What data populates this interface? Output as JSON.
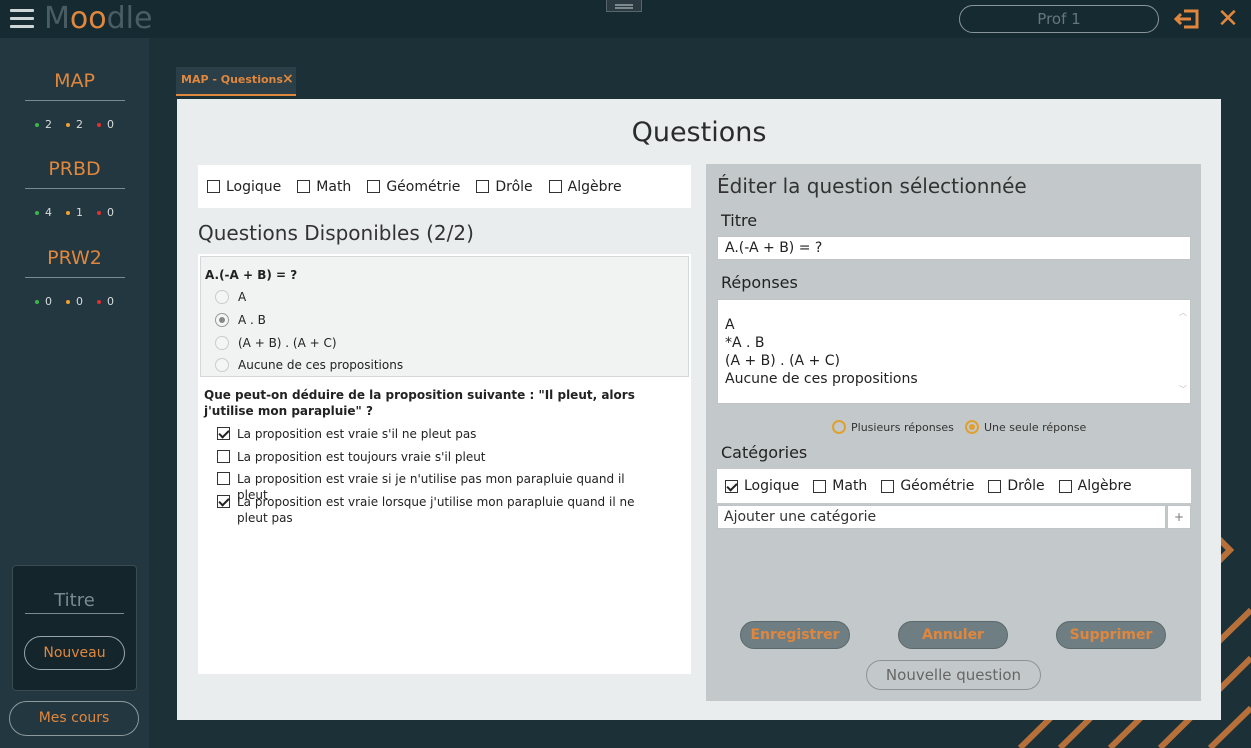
{
  "app": {
    "logo": {
      "m": "M",
      "oo": "oo",
      "dle": "dle"
    },
    "user": "Prof 1"
  },
  "sidebar": {
    "courses": [
      {
        "name": "MAP",
        "green": "2",
        "orange": "2",
        "red": "0"
      },
      {
        "name": "PRBD",
        "green": "4",
        "orange": "1",
        "red": "0"
      },
      {
        "name": "PRW2",
        "green": "0",
        "orange": "0",
        "red": "0"
      }
    ],
    "titre_label": "Titre",
    "nouveau_label": "Nouveau",
    "mescours_label": "Mes cours"
  },
  "tab": {
    "label": "MAP - Questions",
    "close": "×"
  },
  "page": {
    "title": "Questions"
  },
  "filters": [
    {
      "label": "Logique",
      "checked": false
    },
    {
      "label": "Math",
      "checked": false
    },
    {
      "label": "Géométrie",
      "checked": false
    },
    {
      "label": "Drôle",
      "checked": false
    },
    {
      "label": "Algèbre",
      "checked": false
    }
  ],
  "available": {
    "title": "Questions Disponibles (2/2)",
    "q1": {
      "text": "A.(-A + B) = ?",
      "options": [
        "A",
        "A . B",
        "(A + B) . (A + C)",
        "Aucune de ces propositions"
      ],
      "selected_index": 1
    },
    "q2": {
      "text": "Que peut-on déduire de la proposition suivante : \"Il pleut, alors j'utilise mon parapluie\" ?",
      "options": [
        {
          "label": "La proposition est vraie s'il ne pleut pas",
          "checked": true
        },
        {
          "label": "La proposition est toujours vraie s'il pleut",
          "checked": false
        },
        {
          "label": "La proposition est vraie si je n'utilise pas mon parapluie quand il pleut",
          "checked": false
        },
        {
          "label": "La proposition est vraie lorsque j'utilise mon parapluie quand il ne pleut pas",
          "checked": true
        }
      ]
    }
  },
  "editor": {
    "title": "Éditer la question sélectionnée",
    "titre_label": "Titre",
    "titre_value": "A.(-A + B) = ?",
    "reponses_label": "Réponses",
    "answers": [
      "A",
      "*A . B",
      "(A + B) . (A + C)",
      "Aucune de ces propositions"
    ],
    "mode_multi": "Plusieurs réponses",
    "mode_single": "Une seule réponse",
    "mode_selected": "single",
    "categories_label": "Catégories",
    "categories": [
      {
        "label": "Logique",
        "checked": true
      },
      {
        "label": "Math",
        "checked": false
      },
      {
        "label": "Géométrie",
        "checked": false
      },
      {
        "label": "Drôle",
        "checked": false
      },
      {
        "label": "Algèbre",
        "checked": false
      }
    ],
    "add_category": "Ajouter une catégorie",
    "add_category_plus": "+",
    "buttons": {
      "save": "Enregistrer",
      "cancel": "Annuler",
      "delete": "Supprimer",
      "new": "Nouvelle question"
    }
  },
  "colors": {
    "accent": "#e0873d",
    "background": "#1c3038",
    "green": "#3ab54a",
    "orange": "#f0a030",
    "red": "#e03030"
  }
}
